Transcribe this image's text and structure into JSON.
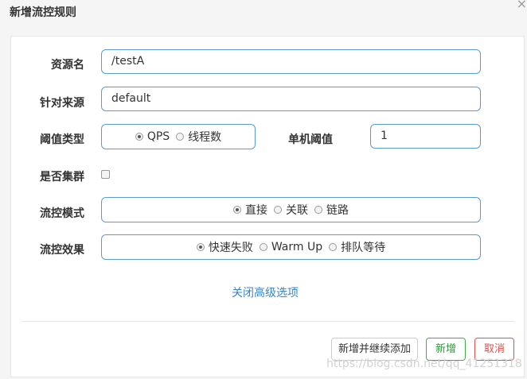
{
  "dialog": {
    "title": "新增流控规则",
    "close": "×"
  },
  "form": {
    "resource": {
      "label": "资源名",
      "value": "/testA"
    },
    "source": {
      "label": "针对来源",
      "value": "default"
    },
    "threshold_type": {
      "label": "阈值类型",
      "options": [
        {
          "label": "QPS",
          "selected": true
        },
        {
          "label": "线程数",
          "selected": false
        }
      ]
    },
    "single_threshold": {
      "label": "单机阈值",
      "value": "1"
    },
    "cluster": {
      "label": "是否集群",
      "checked": false
    },
    "control_mode": {
      "label": "流控模式",
      "options": [
        {
          "label": "直接",
          "selected": true
        },
        {
          "label": "关联",
          "selected": false
        },
        {
          "label": "链路",
          "selected": false
        }
      ]
    },
    "control_effect": {
      "label": "流控效果",
      "options": [
        {
          "label": "快速失败",
          "selected": true
        },
        {
          "label": "Warm Up",
          "selected": false
        },
        {
          "label": "排队等待",
          "selected": false
        }
      ]
    },
    "advanced_link": "关闭高级选项"
  },
  "footer": {
    "add_continue": "新增并继续添加",
    "add": "新增",
    "cancel": "取消"
  },
  "watermark": "https://blog.csdn.net/qq_41251318",
  "colors": {
    "border": "#5b9bd5",
    "link": "#3a83c9",
    "success": "#3fae4b",
    "danger": "#d9534f"
  }
}
